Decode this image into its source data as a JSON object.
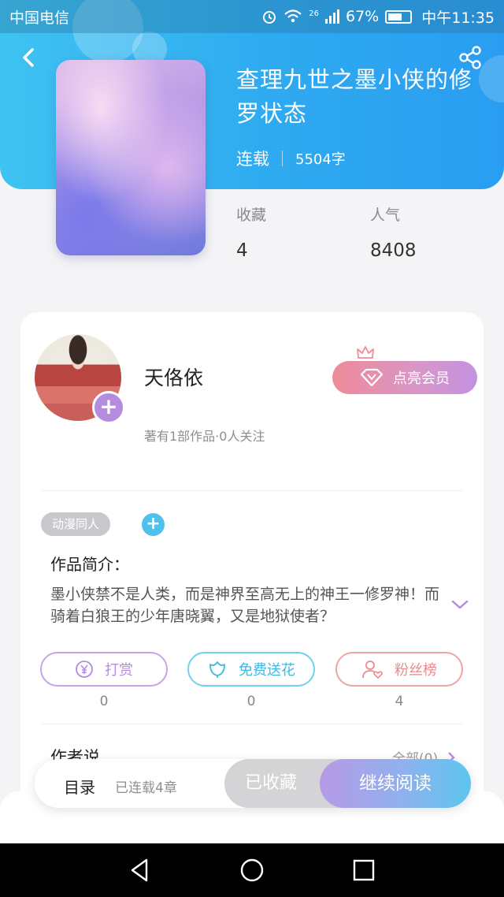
{
  "status_bar": {
    "carrier": "中国电信",
    "network": "26",
    "battery_text": "67%",
    "battery_level": 0.67,
    "time": "中午11:35"
  },
  "book": {
    "title": "查理九世之墨小侠的修罗状态",
    "status": "连载",
    "word_count": "5504字",
    "stats": {
      "favorites_label": "收藏",
      "favorites_value": "4",
      "popularity_label": "人气",
      "popularity_value": "8408"
    }
  },
  "author": {
    "name": "天佫依",
    "info": "著有1部作品·0人关注",
    "vip_label": "点亮会员"
  },
  "tags": [
    "动漫同人"
  ],
  "intro": {
    "label": "作品简介：",
    "text": "墨小侠禁不是人类，而是神界至高无上的神王一修罗神！而骑着白狼王的少年唐晓翼，又是地狱使者？"
  },
  "actions": [
    {
      "label": "打赏",
      "count": "0",
      "icon": "yuan-coin-icon",
      "color": "#b58be0"
    },
    {
      "label": "免费送花",
      "count": "0",
      "icon": "flower-icon",
      "color": "#3fb8e0"
    },
    {
      "label": "粉丝榜",
      "count": "4",
      "icon": "user-heart-icon",
      "color": "#ee8a8a"
    }
  ],
  "author_say": {
    "label": "作者说",
    "all_link": "全部(0)"
  },
  "bottom_bar": {
    "toc_label": "目录",
    "chapter_count": "已连载4章",
    "collected_label": "已收藏",
    "read_label": "继续阅读"
  },
  "colors": {
    "header_blue": "#2eaaf0",
    "accent_purple": "#b58be0",
    "accent_cyan": "#4fc1ec"
  }
}
